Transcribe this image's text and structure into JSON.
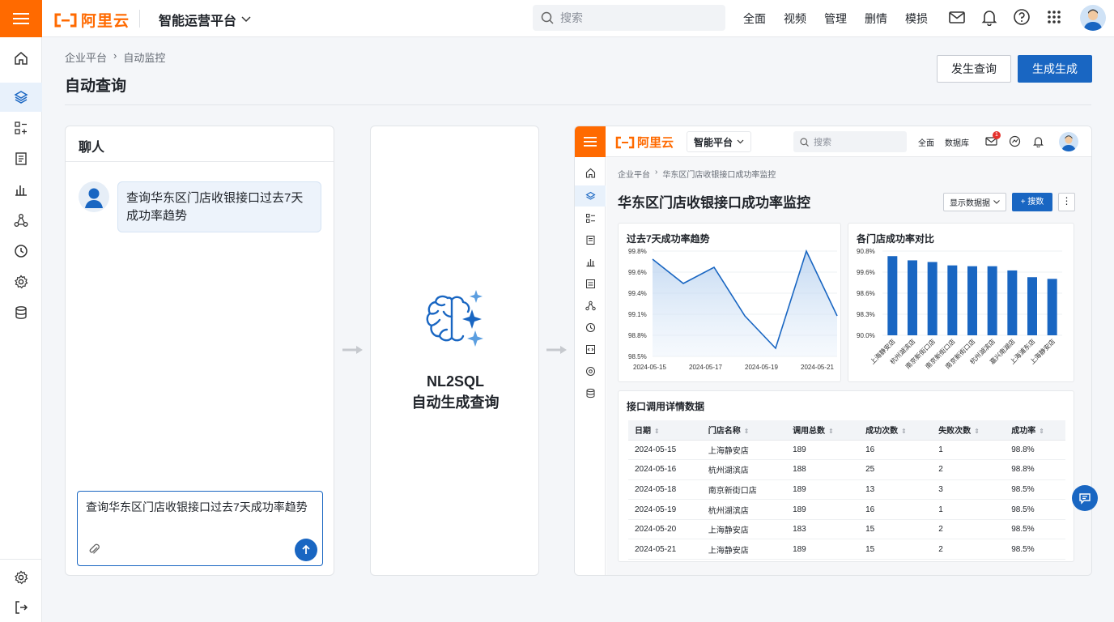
{
  "app": {
    "brand": "阿里云",
    "product": "智能运营平台"
  },
  "topbar": {
    "search_placeholder": "搜索",
    "nav": [
      "全面",
      "视频",
      "管理",
      "删情",
      "模损"
    ]
  },
  "page": {
    "breadcrumb": [
      "企业平台",
      "自动监控"
    ],
    "title": "自动查询",
    "btn_secondary": "发生查询",
    "btn_primary": "生成生成"
  },
  "chat": {
    "title": "聊人",
    "message": "查询华东区门店收银接口过去7天成功率趋势",
    "input_value": "查询华东区门店收银接口过去7天成功率趋势"
  },
  "engine": {
    "line1": "NL2SQL",
    "line2": "自动生成查询"
  },
  "preview": {
    "brand": "阿里云",
    "product": "智能平台",
    "search_placeholder": "搜索",
    "nav": [
      "全面",
      "数据库"
    ],
    "mail_badge": "1",
    "breadcrumb": [
      "企业平台",
      "华东区门店收银接口成功率监控"
    ],
    "title": "华东区门店收银接口成功率监控",
    "select_label": "显示数据据",
    "add_button": "+ 搜数",
    "more_button": "⋮",
    "line_title": "过去7天成功率趋势",
    "bar_title": "各门店成功率对比",
    "table_title": "接口调用详情数据",
    "table": {
      "headers": [
        "日期",
        "门店名称",
        "调用总数",
        "成功次数",
        "失败次数",
        "成功率"
      ],
      "rows": [
        [
          "2024-05-15",
          "上海静安店",
          "189",
          "16",
          "1",
          "98.8%"
        ],
        [
          "2024-05-16",
          "杭州湖滨店",
          "188",
          "25",
          "2",
          "98.8%"
        ],
        [
          "2024-05-18",
          "南京新街口店",
          "189",
          "13",
          "3",
          "98.5%"
        ],
        [
          "2024-05-19",
          "杭州湖滨店",
          "189",
          "16",
          "1",
          "98.5%"
        ],
        [
          "2024-05-20",
          "上海静安店",
          "183",
          "15",
          "2",
          "98.5%"
        ],
        [
          "2024-05-21",
          "上海静安店",
          "189",
          "15",
          "2",
          "98.5%"
        ]
      ]
    }
  },
  "chart_data": [
    {
      "type": "area",
      "title": "过去7天成功率趋势",
      "x_ticks": [
        "2024-05-15",
        "2024-05-17",
        "2024-05-19",
        "2024-05-21"
      ],
      "y_ticks": [
        "99.8%",
        "99.6%",
        "99.4%",
        "99.1%",
        "98.8%",
        "98.5%"
      ],
      "ylim": [
        98.5,
        99.8
      ],
      "values": [
        99.7,
        99.4,
        99.6,
        99.0,
        98.6,
        99.8,
        99.0
      ],
      "color": "#1966c2"
    },
    {
      "type": "bar",
      "title": "各门店成功率对比",
      "categories": [
        "上海静安店",
        "杭州湖滨店",
        "南京新街口店",
        "南京新街口店",
        "南京新街口店",
        "杭州湖滨店",
        "嘉兴南湖店",
        "上海浦东店",
        "上海静安店"
      ],
      "y_ticks": [
        "90.8%",
        "99.6%",
        "98.6%",
        "98.3%",
        "90.0%"
      ],
      "ylim": [
        90.0,
        100.0
      ],
      "values": [
        99.4,
        98.9,
        98.7,
        98.3,
        98.2,
        98.2,
        97.7,
        96.9,
        96.7
      ],
      "color": "#1966c2"
    }
  ]
}
